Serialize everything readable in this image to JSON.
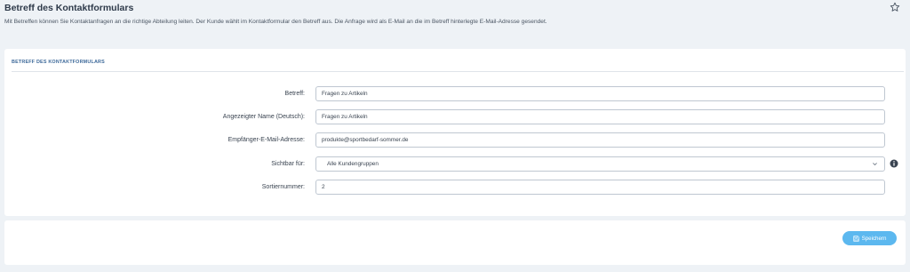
{
  "page": {
    "title": "Betreff des Kontaktformulars",
    "description": "Mit Betreffen können Sie Kontaktanfragen an die richtige Abteilung leiten. Der Kunde wählt im Kontaktformular den Betreff aus. Die Anfrage wird als E-Mail an die im Betreff hinterlegte E-Mail-Adresse gesendet."
  },
  "icons": {
    "favorite": "star-icon",
    "dropdown": "chevron-down-icon",
    "info": "info-icon",
    "save": "floppy-disk-icon"
  },
  "section": {
    "header": "BETREFF DES KONTAKTFORMULARS"
  },
  "form": {
    "subject": {
      "label": "Betreff:",
      "value": "Fragen zu Artikeln"
    },
    "display_name": {
      "label": "Angezeigter Name (Deutsch):",
      "value": "Fragen zu Artikeln"
    },
    "recipient_email": {
      "label": "Empfänger-E-Mail-Adresse:",
      "value": "produkte@sportbedarf-sommer.de"
    },
    "visible_for": {
      "label": "Sichtbar für:",
      "selected": "Alle Kundengruppen"
    },
    "sort_number": {
      "label": "Sortiernummer:",
      "value": "2"
    }
  },
  "footer": {
    "save_label": "Speichern"
  },
  "colors": {
    "background": "#eef2f6",
    "accent": "#5cb8ef",
    "section_header": "#3e6a9a"
  }
}
